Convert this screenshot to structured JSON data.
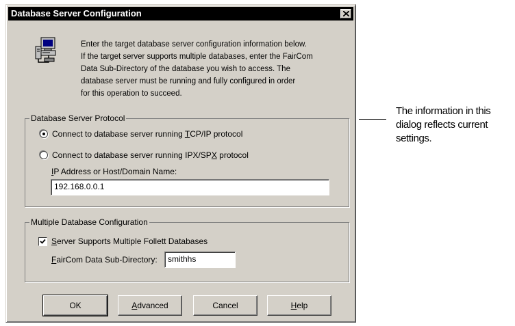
{
  "window": {
    "title": "Database Server Configuration",
    "close_icon": "close-icon"
  },
  "intro": {
    "icon": "computer-network-icon",
    "lines": [
      "Enter the target database server configuration information below.",
      "If the target server supports multiple databases, enter the FairCom",
      "Data Sub-Directory of the database you wish to access.  The",
      "database server must be running and fully configured in order",
      "for this operation to succeed."
    ]
  },
  "protocol_group": {
    "title": "Database Server Protocol",
    "tcp_option": {
      "before": "Connect to database server running ",
      "mnemonic": "T",
      "after": "CP/IP protocol",
      "selected": true
    },
    "ipx_option": {
      "before": "Connect to database server running IPX/SP",
      "mnemonic": "X",
      "after": " protocol",
      "selected": false
    },
    "address_label": {
      "mnemonic": "I",
      "after": "P Address or Host/Domain Name:"
    },
    "address_value": "192.168.0.0.1"
  },
  "multi_db_group": {
    "title": "Multiple Database Configuration",
    "supports_multiple": {
      "mnemonic": "S",
      "after": "erver Supports Multiple Follett Databases",
      "checked": true
    },
    "subdir_label": {
      "mnemonic": "F",
      "after": "airCom Data Sub-Directory:"
    },
    "subdir_value": "smithhs"
  },
  "buttons": {
    "ok": "OK",
    "advanced": {
      "mnemonic": "A",
      "after": "dvanced"
    },
    "cancel": "Cancel",
    "help": {
      "mnemonic": "H",
      "after": "elp"
    }
  },
  "callout": {
    "lines": [
      "The information in this",
      "dialog reflects current",
      "settings."
    ]
  }
}
